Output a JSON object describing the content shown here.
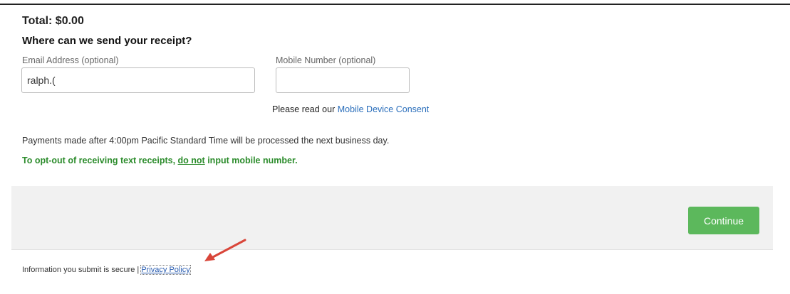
{
  "order": {
    "total_label": "Total: $0.00"
  },
  "receipt": {
    "heading": "Where can we send your receipt?",
    "email_label": "Email Address (optional)",
    "email_value": "ralph.(",
    "mobile_label": "Mobile Number (optional)",
    "mobile_value": "",
    "consent_prefix": "Please read our",
    "consent_link": "Mobile Device Consent"
  },
  "notices": {
    "processing": "Payments made after 4:00pm Pacific Standard Time will be processed the next business day.",
    "optout_before": "To opt-out of receiving text receipts, ",
    "optout_underlined": "do not",
    "optout_after": " input mobile number."
  },
  "actions": {
    "continue_label": "Continue"
  },
  "footer": {
    "secure_text": "Information you submit is secure |",
    "privacy_link": "Privacy Policy"
  },
  "colors": {
    "continue_button": "#5cb85c",
    "optout_text": "#2c8c2c",
    "link": "#2a6ebb",
    "annotation_arrow": "#d9463a"
  }
}
